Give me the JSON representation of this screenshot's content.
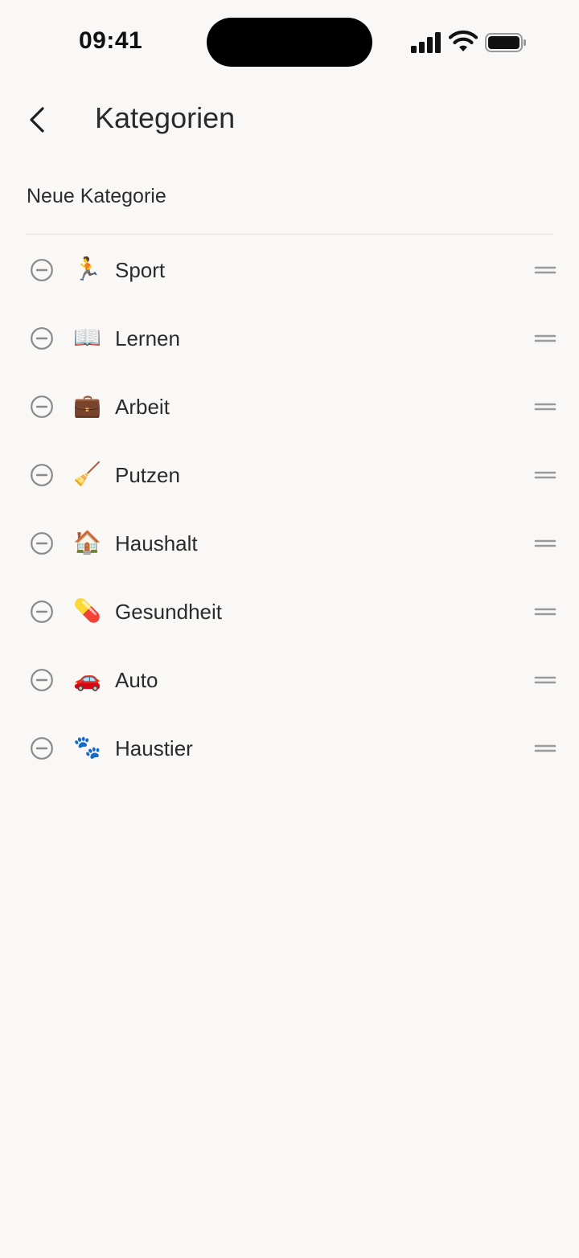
{
  "status_bar": {
    "time": "09:41",
    "icons": [
      "signal-icon",
      "wifi-icon",
      "battery-icon"
    ]
  },
  "header": {
    "back_icon": "chevron-left-icon",
    "title": "Kategorien"
  },
  "new_category": {
    "label": "Neue Kategorie"
  },
  "categories": [
    {
      "emoji": "🏃",
      "label": "Sport"
    },
    {
      "emoji": "📖",
      "label": "Lernen"
    },
    {
      "emoji": "💼",
      "label": "Arbeit"
    },
    {
      "emoji": "🧹",
      "label": "Putzen"
    },
    {
      "emoji": "🏠",
      "label": "Haushalt"
    },
    {
      "emoji": "💊",
      "label": "Gesundheit"
    },
    {
      "emoji": "🚗",
      "label": "Auto"
    },
    {
      "emoji": "🐾",
      "label": "Haustier"
    }
  ],
  "colors": {
    "background": "#f9f8f6",
    "text": "#2b2b2b",
    "icon_gray": "#8a8a8a",
    "divider": "#e6e4e0"
  }
}
